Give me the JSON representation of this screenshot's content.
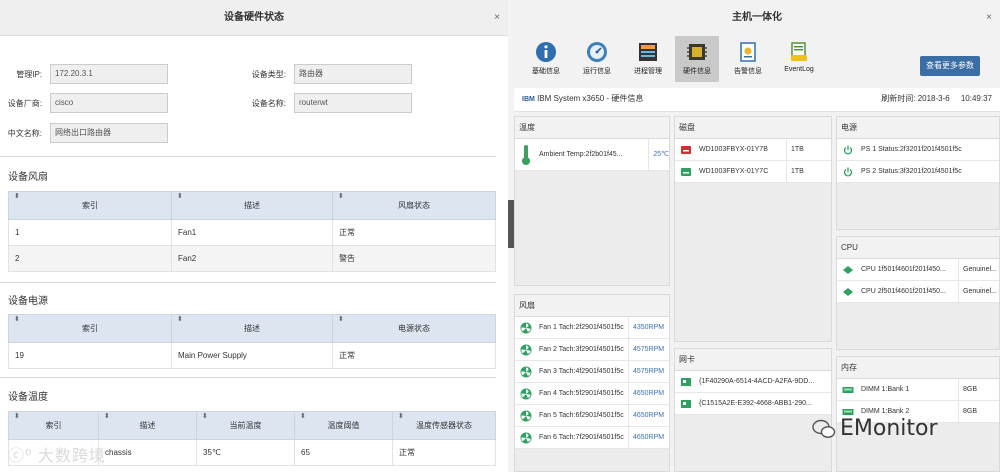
{
  "left": {
    "title": "设备硬件状态",
    "close": "×",
    "fields": [
      {
        "label": "管理IP:",
        "value": "172.20.3.1"
      },
      {
        "label": "设备类型:",
        "value": "路由器"
      },
      {
        "label": "设备厂商:",
        "value": "cisco"
      },
      {
        "label": "设备名称:",
        "value": "routerwt"
      },
      {
        "label": "中文名称:",
        "value": "网络出口路由器"
      }
    ],
    "fan": {
      "title": "设备风扇",
      "headers": [
        "索引",
        "描述",
        "风扇状态"
      ],
      "rows": [
        {
          "index": "1",
          "desc": "Fan1",
          "status": "正常"
        },
        {
          "index": "2",
          "desc": "Fan2",
          "status": "警告"
        }
      ]
    },
    "power": {
      "title": "设备电源",
      "headers": [
        "索引",
        "描述",
        "电源状态"
      ],
      "rows": [
        {
          "index": "19",
          "desc": "Main Power Supply",
          "status": "正常"
        }
      ]
    },
    "temp": {
      "title": "设备温度",
      "headers": [
        "索引",
        "描述",
        "当前温度",
        "温度阈值",
        "温度传感器状态"
      ],
      "rows": [
        {
          "index": "",
          "desc": "chassis",
          "current": "35℃",
          "threshold": "65",
          "status": "正常"
        }
      ]
    },
    "watermark": "大数跨境"
  },
  "right": {
    "title": "主机一体化",
    "close": "×",
    "tools": [
      {
        "label": "基础信息",
        "icon": "info-icon"
      },
      {
        "label": "运行信息",
        "icon": "gauge-icon"
      },
      {
        "label": "进程管理",
        "icon": "process-icon"
      },
      {
        "label": "硬件信息",
        "icon": "hardware-chip-icon"
      },
      {
        "label": "告警信息",
        "icon": "alarm-doc-icon"
      },
      {
        "label": "EventLog",
        "icon": "eventlog-icon"
      }
    ],
    "more_button": "查看更多参数",
    "info": {
      "logo": "IBM",
      "system": "IBM System x3650 - 硬件信息",
      "refresh_label": "刷新时间:",
      "refresh_date": "2018-3-6",
      "refresh_time": "10:49:37"
    },
    "temperature": {
      "title": "温度",
      "rows": [
        {
          "name": "Ambient Temp:2f2b01f45...",
          "value": "25℃"
        }
      ]
    },
    "disk": {
      "title": "磁盘",
      "rows": [
        {
          "name": "WD1003FBYX-01Y7B",
          "value": "1TB",
          "state": "error"
        },
        {
          "name": "WD1003FBYX-01Y7C",
          "value": "1TB",
          "state": "ok"
        }
      ]
    },
    "psu": {
      "title": "电源",
      "rows": [
        {
          "name": "PS 1 Status:2f3201f201f4501f5c"
        },
        {
          "name": "PS 2 Status:3f3201f201f4501f5c"
        }
      ]
    },
    "cpu": {
      "title": "CPU",
      "rows": [
        {
          "name": "CPU 1f501f4601f201f450...",
          "value": "Genuinel..."
        },
        {
          "name": "CPU 2f501f4601f201f450...",
          "value": "Genuinel..."
        }
      ]
    },
    "fans": {
      "title": "风扇",
      "rows": [
        {
          "name": "Fan 1 Tach:2f2901f4501f5c",
          "value": "4350RPM"
        },
        {
          "name": "Fan 2 Tach:3f2901f4501f5c",
          "value": "4575RPM"
        },
        {
          "name": "Fan 3 Tach:4f2901f4501f5c",
          "value": "4575RPM"
        },
        {
          "name": "Fan 4 Tach:5f2901f4501f5c",
          "value": "4650RPM"
        },
        {
          "name": "Fan 5 Tach:6f2901f4501f5c",
          "value": "4650RPM"
        },
        {
          "name": "Fan 6 Tach:7f2901f4501f5c",
          "value": "4650RPM"
        }
      ]
    },
    "nic": {
      "title": "网卡",
      "rows": [
        {
          "name": "{1F40290A-6514-4ACD-A2FA-9DD..."
        },
        {
          "name": "{C1515A2E-E392-4668-ABB1-290..."
        }
      ]
    },
    "memory": {
      "title": "内存",
      "rows": [
        {
          "name": "DIMM 1:Bank 1",
          "value": "8GB"
        },
        {
          "name": "DIMM 1:Bank 2",
          "value": "8GB"
        }
      ]
    },
    "brand": "EMonitor",
    "colors": {
      "accent": "#3a6ea5",
      "link_value": "#3a72b8",
      "warning": "#e02020",
      "table_header": "#dde5f1"
    }
  }
}
